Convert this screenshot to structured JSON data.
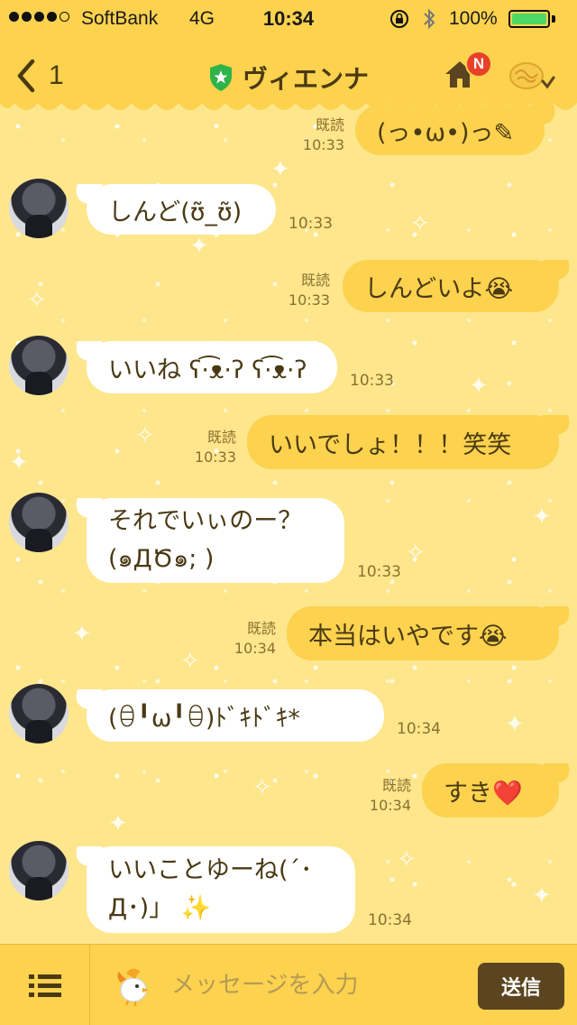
{
  "status_bar": {
    "carrier": "SoftBank",
    "network": "4G",
    "time": "10:34",
    "battery_percent": "100%",
    "icons": [
      "signal-dots",
      "lock-rotation-icon",
      "bluetooth-icon",
      "battery-icon"
    ]
  },
  "header": {
    "back_count": "1",
    "title": "ヴィエンナ",
    "home_badge": "N",
    "icons": [
      "back-chevron-icon",
      "shield-star-icon",
      "home-icon",
      "menu-brain-icon"
    ]
  },
  "messages": [
    {
      "side": "right",
      "text": "(っ•ω•)っ✎",
      "read": "既読",
      "time": "10:33"
    },
    {
      "side": "left",
      "text": "しんど(ʊ̃_ʊ̃)",
      "time": "10:33"
    },
    {
      "side": "right",
      "text": "しんどいよ😭",
      "read": "既読",
      "time": "10:33"
    },
    {
      "side": "left",
      "text": "いいね ʕ·͡ᴥ·ʔ ʕ·͡ᴥ·ʔ",
      "time": "10:33"
    },
    {
      "side": "right",
      "text": "いいでしょ！！！笑笑",
      "read": "既読",
      "time": "10:33"
    },
    {
      "side": "left",
      "line1": "それでいぃのー？",
      "line2": "(๑ДԾ๑; )",
      "time": "10:33"
    },
    {
      "side": "right",
      "text": "本当はいやです😭",
      "read": "既読",
      "time": "10:34"
    },
    {
      "side": "left",
      "text": "(ꃪ╹ω╹ꃪ)ﾄﾞｷﾄﾞｷ*",
      "time": "10:34"
    },
    {
      "side": "right",
      "text": "すき❤️",
      "read": "既読",
      "time": "10:34"
    },
    {
      "side": "left",
      "line1": "いいことゆーね(´･",
      "line2": "Д･)」 ✨",
      "time": "10:34"
    }
  ],
  "input_bar": {
    "placeholder": "メッセージを入力",
    "send_label": "送信",
    "icons": [
      "list-icon",
      "bird-sticker-icon"
    ]
  },
  "colors": {
    "header_bg": "#fcd24e",
    "chat_bg": "#fde68c",
    "left_bubble": "#ffffff",
    "right_bubble": "#fcd24e",
    "text": "#4a3a14",
    "meta_text": "#8a7030",
    "badge": "#e8412a",
    "send_button": "#5a4520"
  }
}
